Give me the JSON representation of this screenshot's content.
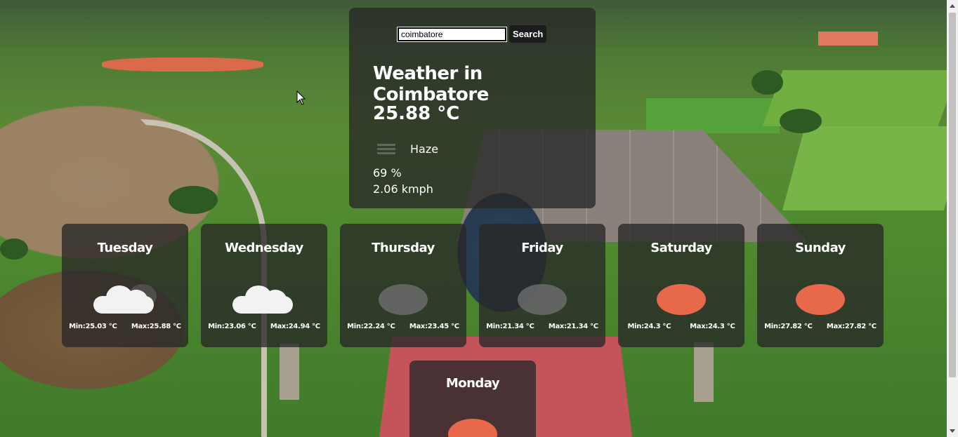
{
  "search": {
    "value": "coimbatore",
    "button_label": "Search"
  },
  "current": {
    "title": "Weather in Coimbatore",
    "temperature": "25.88 °C",
    "condition": "Haze",
    "humidity": "69 %",
    "wind": "2.06 kmph"
  },
  "forecast": [
    {
      "day": "Tuesday",
      "min": "Min:25.03 °C",
      "max": "Max:25.88 °C",
      "icon": "cloud-icon"
    },
    {
      "day": "Wednesday",
      "min": "Min:23.06 °C",
      "max": "Max:24.94 °C",
      "icon": "cloud-icon"
    },
    {
      "day": "Thursday",
      "min": "Min:22.24 °C",
      "max": "Max:23.45 °C",
      "icon": "haze-icon"
    },
    {
      "day": "Friday",
      "min": "Min:21.34 °C",
      "max": "Max:21.34 °C",
      "icon": "haze-icon"
    },
    {
      "day": "Saturday",
      "min": "Min:24.3 °C",
      "max": "Max:24.3 °C",
      "icon": "sun-icon"
    },
    {
      "day": "Sunday",
      "min": "Min:27.82 °C",
      "max": "Max:27.82 °C",
      "icon": "sun-icon"
    },
    {
      "day": "Monday",
      "min": "",
      "max": "",
      "icon": "sun-icon"
    }
  ],
  "colors": {
    "card": "#282828",
    "sun": "#e8684a",
    "cloud": "#f2f2f2"
  }
}
